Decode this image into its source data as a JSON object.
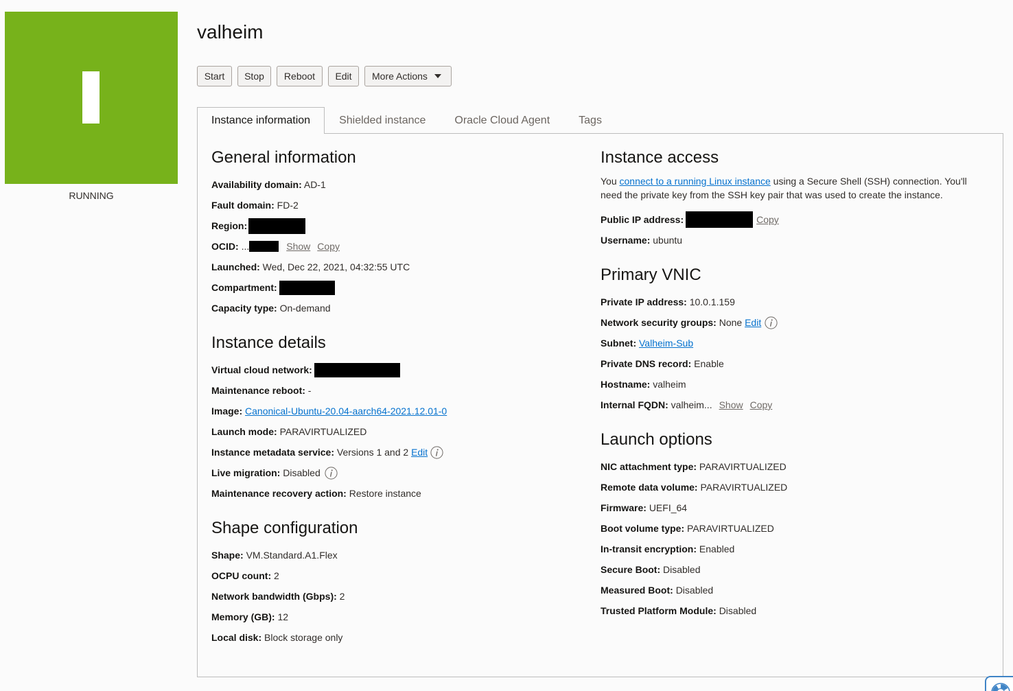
{
  "instance": {
    "name": "valheim",
    "status_label": "RUNNING",
    "status_color": "#77b21b"
  },
  "theme": {
    "link": "#0572ce"
  },
  "actions": {
    "start": "Start",
    "stop": "Stop",
    "reboot": "Reboot",
    "edit": "Edit",
    "more_actions": "More Actions"
  },
  "tabs": [
    {
      "label": "Instance information",
      "active": true
    },
    {
      "label": "Shielded instance",
      "active": false
    },
    {
      "label": "Oracle Cloud Agent",
      "active": false
    },
    {
      "label": "Tags",
      "active": false
    }
  ],
  "general_information": {
    "heading": "General information",
    "availability_domain": {
      "label": "Availability domain:",
      "value": "AD-1"
    },
    "fault_domain": {
      "label": "Fault domain:",
      "value": "FD-2"
    },
    "region": {
      "label": "Region:"
    },
    "ocid": {
      "label": "OCID:",
      "value": "...",
      "show": "Show",
      "copy": "Copy"
    },
    "launched": {
      "label": "Launched:",
      "value": "Wed, Dec 22, 2021, 04:32:55 UTC"
    },
    "compartment": {
      "label": "Compartment:"
    },
    "capacity_type": {
      "label": "Capacity type:",
      "value": "On-demand"
    }
  },
  "instance_details": {
    "heading": "Instance details",
    "virtual_cloud_network": {
      "label": "Virtual cloud network:"
    },
    "maintenance_reboot": {
      "label": "Maintenance reboot:",
      "value": "-"
    },
    "image": {
      "label": "Image:",
      "link": "Canonical-Ubuntu-20.04-aarch64-2021.12.01-0"
    },
    "launch_mode": {
      "label": "Launch mode:",
      "value": "PARAVIRTUALIZED"
    },
    "instance_metadata_service": {
      "label": "Instance metadata service:",
      "value": "Versions 1 and 2",
      "edit": "Edit"
    },
    "live_migration": {
      "label": "Live migration:",
      "value": "Disabled"
    },
    "maintenance_recovery_action": {
      "label": "Maintenance recovery action:",
      "value": "Restore instance"
    }
  },
  "shape_configuration": {
    "heading": "Shape configuration",
    "shape": {
      "label": "Shape:",
      "value": "VM.Standard.A1.Flex"
    },
    "ocpu_count": {
      "label": "OCPU count:",
      "value": "2"
    },
    "network_bandwidth": {
      "label": "Network bandwidth (Gbps):",
      "value": "2"
    },
    "memory": {
      "label": "Memory (GB):",
      "value": "12"
    },
    "local_disk": {
      "label": "Local disk:",
      "value": "Block storage only"
    }
  },
  "instance_access": {
    "heading": "Instance access",
    "intro_prefix": "You",
    "intro_link": "connect to a running Linux instance",
    "intro_line1_rest": "using a Secure Shell (SSH) connection. You'll",
    "intro_line2": "need the private key from the SSH key pair that was used to create the instance.",
    "public_ip": {
      "label": "Public IP address:",
      "copy": "Copy"
    },
    "username": {
      "label": "Username:",
      "value": "ubuntu"
    }
  },
  "primary_vnic": {
    "heading": "Primary VNIC",
    "private_ip": {
      "label": "Private IP address:",
      "value": "10.0.1.159"
    },
    "network_security_groups": {
      "label": "Network security groups:",
      "value": "None",
      "edit": "Edit"
    },
    "subnet": {
      "label": "Subnet:",
      "link": "Valheim-Sub"
    },
    "private_dns_record": {
      "label": "Private DNS record:",
      "value": "Enable"
    },
    "hostname": {
      "label": "Hostname:",
      "value": "valheim"
    },
    "internal_fqdn": {
      "label": "Internal FQDN:",
      "value": "valheim...",
      "show": "Show",
      "copy": "Copy"
    }
  },
  "launch_options": {
    "heading": "Launch options",
    "nic_attachment_type": {
      "label": "NIC attachment type:",
      "value": "PARAVIRTUALIZED"
    },
    "remote_data_volume": {
      "label": "Remote data volume:",
      "value": "PARAVIRTUALIZED"
    },
    "firmware": {
      "label": "Firmware:",
      "value": "UEFI_64"
    },
    "boot_volume_type": {
      "label": "Boot volume type:",
      "value": "PARAVIRTUALIZED"
    },
    "in_transit_encryption": {
      "label": "In-transit encryption:",
      "value": "Enabled"
    },
    "secure_boot": {
      "label": "Secure Boot:",
      "value": "Disabled"
    },
    "measured_boot": {
      "label": "Measured Boot:",
      "value": "Disabled"
    },
    "trusted_platform_module": {
      "label": "Trusted Platform Module:",
      "value": "Disabled"
    }
  },
  "icons": {
    "info": "info-icon",
    "more_actions_caret": "caret-down-icon",
    "help": "lifebuoy-icon"
  }
}
